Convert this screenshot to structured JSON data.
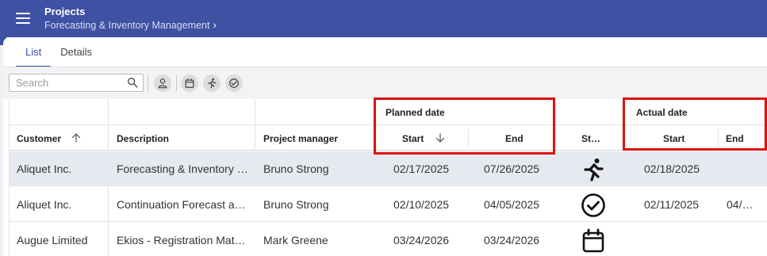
{
  "header": {
    "title": "Projects",
    "breadcrumb": "Forecasting & Inventory Management",
    "menu_icon": "hamburger-menu-icon"
  },
  "tabs": [
    {
      "label": "List",
      "active": true
    },
    {
      "label": "Details",
      "active": false
    }
  ],
  "toolbar": {
    "search_placeholder": "Search",
    "buttons": [
      "person-icon",
      "calendar-icon",
      "running-person-icon",
      "check-circle-icon"
    ]
  },
  "grid": {
    "groups": {
      "planned": "Planned date",
      "actual": "Actual date"
    },
    "columns": {
      "customer": "Customer",
      "description": "Description",
      "manager": "Project manager",
      "planned_start": "Start",
      "planned_end": "End",
      "status": "St…",
      "actual_start": "Start",
      "actual_end": "End"
    },
    "rows": [
      {
        "customer": "Aliquet Inc.",
        "description": "Forecasting & Inventory …",
        "manager": "Bruno Strong",
        "planned_start": "02/17/2025",
        "planned_end": "07/26/2025",
        "status": "running-person-icon",
        "actual_start": "02/18/2025",
        "actual_end": "",
        "selected": true
      },
      {
        "customer": "Aliquet Inc.",
        "description": "Continuation Forecast a…",
        "manager": "Bruno Strong",
        "planned_start": "02/10/2025",
        "planned_end": "04/05/2025",
        "status": "check-circle-icon",
        "actual_start": "02/11/2025",
        "actual_end": "04/…",
        "selected": false
      },
      {
        "customer": "Augue Limited",
        "description": "Ekios - Registration Mate…",
        "manager": "Mark Greene",
        "planned_start": "03/24/2026",
        "planned_end": "03/24/2026",
        "status": "calendar-icon",
        "actual_start": "",
        "actual_end": "",
        "selected": false
      }
    ]
  },
  "colors": {
    "brand": "#3f51a3",
    "highlight": "#e01010",
    "selected_row": "#e7e9f1"
  }
}
